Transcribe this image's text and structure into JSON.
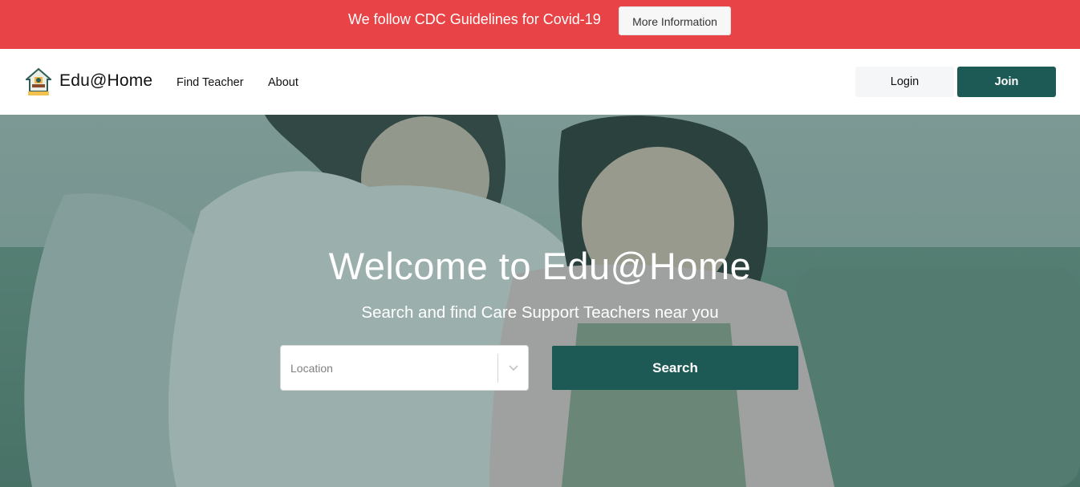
{
  "banner": {
    "text": "We follow CDC Guidelines for Covid-19",
    "button_label": "More Information",
    "background_color": "#e84346"
  },
  "nav": {
    "logo_icon": "house-logo-icon",
    "logo_text": "Edu@Home",
    "links": [
      {
        "label": "Find Teacher"
      },
      {
        "label": "About"
      }
    ],
    "login_label": "Login",
    "join_label": "Join",
    "accent_color": "#1e5a55"
  },
  "hero": {
    "title": "Welcome to Edu@Home",
    "subtitle": "Search and find Care Support Teachers near you",
    "location_placeholder": "Location",
    "search_label": "Search",
    "dropdown_icon": "chevron-down-icon"
  }
}
